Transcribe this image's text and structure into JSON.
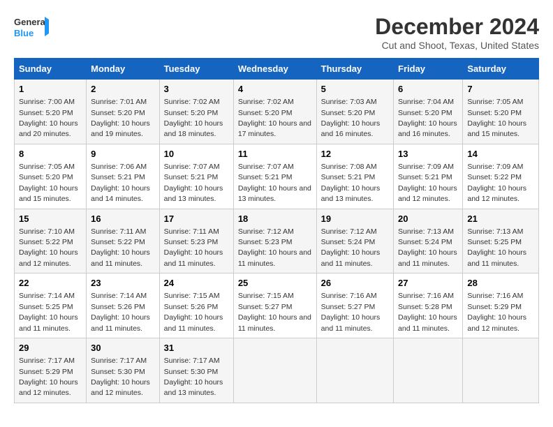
{
  "logo": {
    "line1": "General",
    "line2": "Blue"
  },
  "title": "December 2024",
  "location": "Cut and Shoot, Texas, United States",
  "days_of_week": [
    "Sunday",
    "Monday",
    "Tuesday",
    "Wednesday",
    "Thursday",
    "Friday",
    "Saturday"
  ],
  "weeks": [
    [
      {
        "day": "1",
        "sunrise": "7:00 AM",
        "sunset": "5:20 PM",
        "daylight": "10 hours and 20 minutes."
      },
      {
        "day": "2",
        "sunrise": "7:01 AM",
        "sunset": "5:20 PM",
        "daylight": "10 hours and 19 minutes."
      },
      {
        "day": "3",
        "sunrise": "7:02 AM",
        "sunset": "5:20 PM",
        "daylight": "10 hours and 18 minutes."
      },
      {
        "day": "4",
        "sunrise": "7:02 AM",
        "sunset": "5:20 PM",
        "daylight": "10 hours and 17 minutes."
      },
      {
        "day": "5",
        "sunrise": "7:03 AM",
        "sunset": "5:20 PM",
        "daylight": "10 hours and 16 minutes."
      },
      {
        "day": "6",
        "sunrise": "7:04 AM",
        "sunset": "5:20 PM",
        "daylight": "10 hours and 16 minutes."
      },
      {
        "day": "7",
        "sunrise": "7:05 AM",
        "sunset": "5:20 PM",
        "daylight": "10 hours and 15 minutes."
      }
    ],
    [
      {
        "day": "8",
        "sunrise": "7:05 AM",
        "sunset": "5:20 PM",
        "daylight": "10 hours and 15 minutes."
      },
      {
        "day": "9",
        "sunrise": "7:06 AM",
        "sunset": "5:21 PM",
        "daylight": "10 hours and 14 minutes."
      },
      {
        "day": "10",
        "sunrise": "7:07 AM",
        "sunset": "5:21 PM",
        "daylight": "10 hours and 13 minutes."
      },
      {
        "day": "11",
        "sunrise": "7:07 AM",
        "sunset": "5:21 PM",
        "daylight": "10 hours and 13 minutes."
      },
      {
        "day": "12",
        "sunrise": "7:08 AM",
        "sunset": "5:21 PM",
        "daylight": "10 hours and 13 minutes."
      },
      {
        "day": "13",
        "sunrise": "7:09 AM",
        "sunset": "5:21 PM",
        "daylight": "10 hours and 12 minutes."
      },
      {
        "day": "14",
        "sunrise": "7:09 AM",
        "sunset": "5:22 PM",
        "daylight": "10 hours and 12 minutes."
      }
    ],
    [
      {
        "day": "15",
        "sunrise": "7:10 AM",
        "sunset": "5:22 PM",
        "daylight": "10 hours and 12 minutes."
      },
      {
        "day": "16",
        "sunrise": "7:11 AM",
        "sunset": "5:22 PM",
        "daylight": "10 hours and 11 minutes."
      },
      {
        "day": "17",
        "sunrise": "7:11 AM",
        "sunset": "5:23 PM",
        "daylight": "10 hours and 11 minutes."
      },
      {
        "day": "18",
        "sunrise": "7:12 AM",
        "sunset": "5:23 PM",
        "daylight": "10 hours and 11 minutes."
      },
      {
        "day": "19",
        "sunrise": "7:12 AM",
        "sunset": "5:24 PM",
        "daylight": "10 hours and 11 minutes."
      },
      {
        "day": "20",
        "sunrise": "7:13 AM",
        "sunset": "5:24 PM",
        "daylight": "10 hours and 11 minutes."
      },
      {
        "day": "21",
        "sunrise": "7:13 AM",
        "sunset": "5:25 PM",
        "daylight": "10 hours and 11 minutes."
      }
    ],
    [
      {
        "day": "22",
        "sunrise": "7:14 AM",
        "sunset": "5:25 PM",
        "daylight": "10 hours and 11 minutes."
      },
      {
        "day": "23",
        "sunrise": "7:14 AM",
        "sunset": "5:26 PM",
        "daylight": "10 hours and 11 minutes."
      },
      {
        "day": "24",
        "sunrise": "7:15 AM",
        "sunset": "5:26 PM",
        "daylight": "10 hours and 11 minutes."
      },
      {
        "day": "25",
        "sunrise": "7:15 AM",
        "sunset": "5:27 PM",
        "daylight": "10 hours and 11 minutes."
      },
      {
        "day": "26",
        "sunrise": "7:16 AM",
        "sunset": "5:27 PM",
        "daylight": "10 hours and 11 minutes."
      },
      {
        "day": "27",
        "sunrise": "7:16 AM",
        "sunset": "5:28 PM",
        "daylight": "10 hours and 11 minutes."
      },
      {
        "day": "28",
        "sunrise": "7:16 AM",
        "sunset": "5:29 PM",
        "daylight": "10 hours and 12 minutes."
      }
    ],
    [
      {
        "day": "29",
        "sunrise": "7:17 AM",
        "sunset": "5:29 PM",
        "daylight": "10 hours and 12 minutes."
      },
      {
        "day": "30",
        "sunrise": "7:17 AM",
        "sunset": "5:30 PM",
        "daylight": "10 hours and 12 minutes."
      },
      {
        "day": "31",
        "sunrise": "7:17 AM",
        "sunset": "5:30 PM",
        "daylight": "10 hours and 13 minutes."
      },
      null,
      null,
      null,
      null
    ]
  ]
}
